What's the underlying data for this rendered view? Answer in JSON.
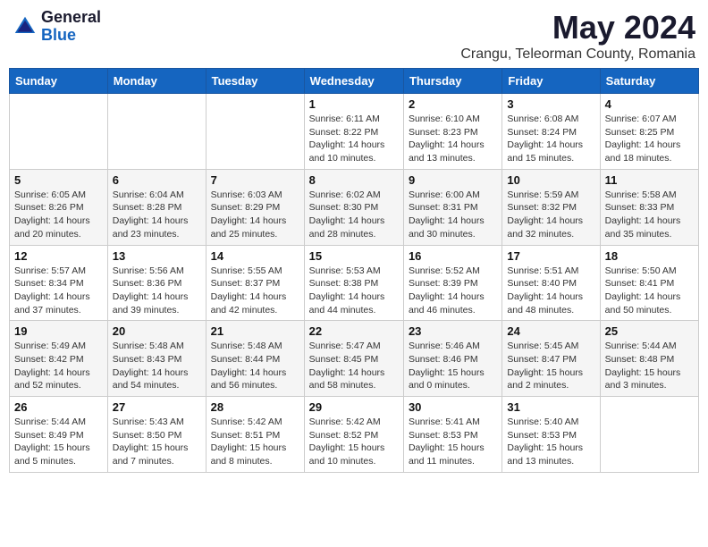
{
  "header": {
    "logo_general": "General",
    "logo_blue": "Blue",
    "month_title": "May 2024",
    "location": "Crangu, Teleorman County, Romania"
  },
  "days_of_week": [
    "Sunday",
    "Monday",
    "Tuesday",
    "Wednesday",
    "Thursday",
    "Friday",
    "Saturday"
  ],
  "weeks": [
    {
      "row_class": "row-white",
      "days": [
        {
          "number": "",
          "info": ""
        },
        {
          "number": "",
          "info": ""
        },
        {
          "number": "",
          "info": ""
        },
        {
          "number": "1",
          "info": "Sunrise: 6:11 AM\nSunset: 8:22 PM\nDaylight: 14 hours\nand 10 minutes."
        },
        {
          "number": "2",
          "info": "Sunrise: 6:10 AM\nSunset: 8:23 PM\nDaylight: 14 hours\nand 13 minutes."
        },
        {
          "number": "3",
          "info": "Sunrise: 6:08 AM\nSunset: 8:24 PM\nDaylight: 14 hours\nand 15 minutes."
        },
        {
          "number": "4",
          "info": "Sunrise: 6:07 AM\nSunset: 8:25 PM\nDaylight: 14 hours\nand 18 minutes."
        }
      ]
    },
    {
      "row_class": "row-alt",
      "days": [
        {
          "number": "5",
          "info": "Sunrise: 6:05 AM\nSunset: 8:26 PM\nDaylight: 14 hours\nand 20 minutes."
        },
        {
          "number": "6",
          "info": "Sunrise: 6:04 AM\nSunset: 8:28 PM\nDaylight: 14 hours\nand 23 minutes."
        },
        {
          "number": "7",
          "info": "Sunrise: 6:03 AM\nSunset: 8:29 PM\nDaylight: 14 hours\nand 25 minutes."
        },
        {
          "number": "8",
          "info": "Sunrise: 6:02 AM\nSunset: 8:30 PM\nDaylight: 14 hours\nand 28 minutes."
        },
        {
          "number": "9",
          "info": "Sunrise: 6:00 AM\nSunset: 8:31 PM\nDaylight: 14 hours\nand 30 minutes."
        },
        {
          "number": "10",
          "info": "Sunrise: 5:59 AM\nSunset: 8:32 PM\nDaylight: 14 hours\nand 32 minutes."
        },
        {
          "number": "11",
          "info": "Sunrise: 5:58 AM\nSunset: 8:33 PM\nDaylight: 14 hours\nand 35 minutes."
        }
      ]
    },
    {
      "row_class": "row-white",
      "days": [
        {
          "number": "12",
          "info": "Sunrise: 5:57 AM\nSunset: 8:34 PM\nDaylight: 14 hours\nand 37 minutes."
        },
        {
          "number": "13",
          "info": "Sunrise: 5:56 AM\nSunset: 8:36 PM\nDaylight: 14 hours\nand 39 minutes."
        },
        {
          "number": "14",
          "info": "Sunrise: 5:55 AM\nSunset: 8:37 PM\nDaylight: 14 hours\nand 42 minutes."
        },
        {
          "number": "15",
          "info": "Sunrise: 5:53 AM\nSunset: 8:38 PM\nDaylight: 14 hours\nand 44 minutes."
        },
        {
          "number": "16",
          "info": "Sunrise: 5:52 AM\nSunset: 8:39 PM\nDaylight: 14 hours\nand 46 minutes."
        },
        {
          "number": "17",
          "info": "Sunrise: 5:51 AM\nSunset: 8:40 PM\nDaylight: 14 hours\nand 48 minutes."
        },
        {
          "number": "18",
          "info": "Sunrise: 5:50 AM\nSunset: 8:41 PM\nDaylight: 14 hours\nand 50 minutes."
        }
      ]
    },
    {
      "row_class": "row-alt",
      "days": [
        {
          "number": "19",
          "info": "Sunrise: 5:49 AM\nSunset: 8:42 PM\nDaylight: 14 hours\nand 52 minutes."
        },
        {
          "number": "20",
          "info": "Sunrise: 5:48 AM\nSunset: 8:43 PM\nDaylight: 14 hours\nand 54 minutes."
        },
        {
          "number": "21",
          "info": "Sunrise: 5:48 AM\nSunset: 8:44 PM\nDaylight: 14 hours\nand 56 minutes."
        },
        {
          "number": "22",
          "info": "Sunrise: 5:47 AM\nSunset: 8:45 PM\nDaylight: 14 hours\nand 58 minutes."
        },
        {
          "number": "23",
          "info": "Sunrise: 5:46 AM\nSunset: 8:46 PM\nDaylight: 15 hours\nand 0 minutes."
        },
        {
          "number": "24",
          "info": "Sunrise: 5:45 AM\nSunset: 8:47 PM\nDaylight: 15 hours\nand 2 minutes."
        },
        {
          "number": "25",
          "info": "Sunrise: 5:44 AM\nSunset: 8:48 PM\nDaylight: 15 hours\nand 3 minutes."
        }
      ]
    },
    {
      "row_class": "row-white",
      "days": [
        {
          "number": "26",
          "info": "Sunrise: 5:44 AM\nSunset: 8:49 PM\nDaylight: 15 hours\nand 5 minutes."
        },
        {
          "number": "27",
          "info": "Sunrise: 5:43 AM\nSunset: 8:50 PM\nDaylight: 15 hours\nand 7 minutes."
        },
        {
          "number": "28",
          "info": "Sunrise: 5:42 AM\nSunset: 8:51 PM\nDaylight: 15 hours\nand 8 minutes."
        },
        {
          "number": "29",
          "info": "Sunrise: 5:42 AM\nSunset: 8:52 PM\nDaylight: 15 hours\nand 10 minutes."
        },
        {
          "number": "30",
          "info": "Sunrise: 5:41 AM\nSunset: 8:53 PM\nDaylight: 15 hours\nand 11 minutes."
        },
        {
          "number": "31",
          "info": "Sunrise: 5:40 AM\nSunset: 8:53 PM\nDaylight: 15 hours\nand 13 minutes."
        },
        {
          "number": "",
          "info": ""
        }
      ]
    }
  ]
}
